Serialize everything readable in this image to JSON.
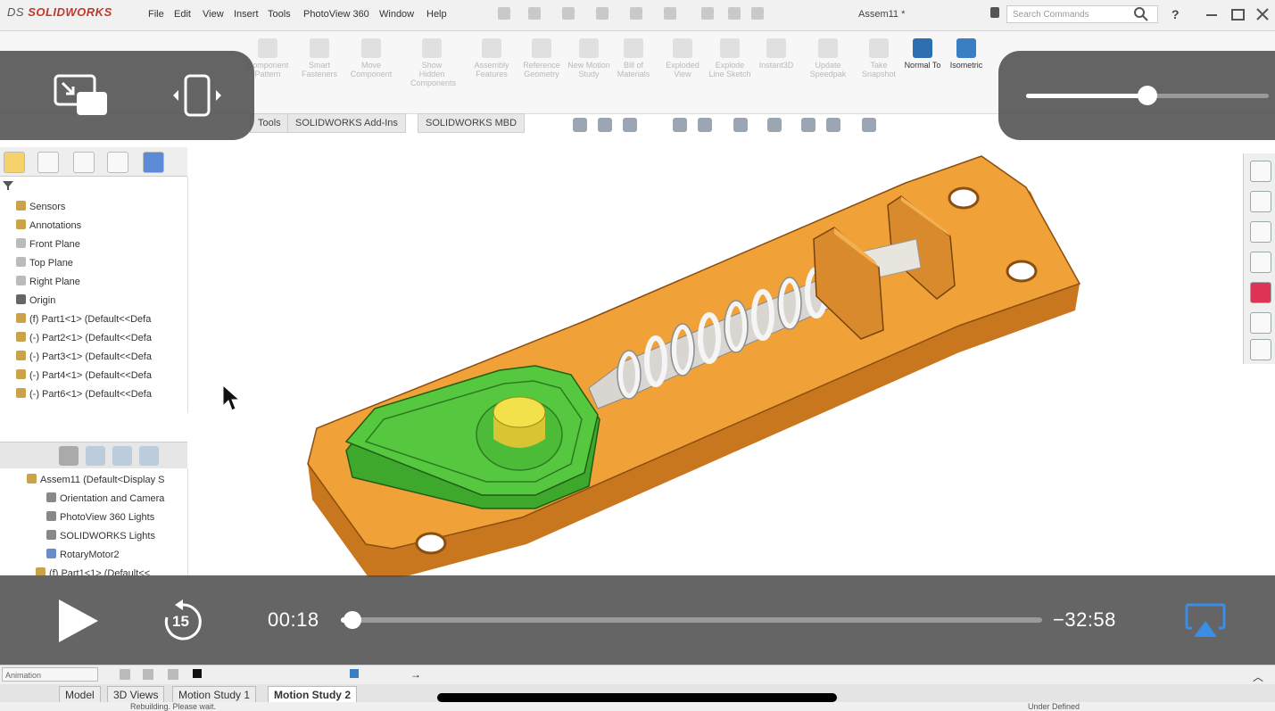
{
  "app": {
    "logo_brand": "SOLIDWORKS",
    "logo_prefix": "DS",
    "menus": [
      "File",
      "Edit",
      "View",
      "Insert",
      "Tools",
      "PhotoView 360",
      "Window",
      "Help"
    ],
    "document_title": "Assem11 *",
    "search_placeholder": "Search Commands",
    "help_label": "?"
  },
  "ribbon": {
    "buttons": [
      {
        "label": "Component Pattern",
        "icon": "pattern-icon",
        "active": false
      },
      {
        "label": "Smart Fasteners",
        "icon": "fastener-icon",
        "active": false
      },
      {
        "label": "Move Component",
        "icon": "move-icon",
        "active": false
      },
      {
        "label": "Show Hidden Components",
        "icon": "show-hidden-icon",
        "active": false
      },
      {
        "label": "Assembly Features",
        "icon": "assembly-feature-icon",
        "active": false
      },
      {
        "label": "Reference Geometry",
        "icon": "reference-geometry-icon",
        "active": false
      },
      {
        "label": "New Motion Study",
        "icon": "motion-study-icon",
        "active": false
      },
      {
        "label": "Bill of Materials",
        "icon": "bom-icon",
        "active": false
      },
      {
        "label": "Exploded View",
        "icon": "exploded-view-icon",
        "active": false
      },
      {
        "label": "Explode Line Sketch",
        "icon": "explode-line-icon",
        "active": false
      },
      {
        "label": "Instant3D",
        "icon": "instant3d-icon",
        "active": false
      },
      {
        "label": "Update Speedpak",
        "icon": "speedpak-icon",
        "active": false
      },
      {
        "label": "Take Snapshot",
        "icon": "snapshot-icon",
        "active": false
      },
      {
        "label": "Normal To",
        "icon": "normal-to-icon",
        "active": true
      },
      {
        "label": "Isometric",
        "icon": "isometric-icon",
        "active": true
      }
    ]
  },
  "tabs": [
    "Tools",
    "SOLIDWORKS Add-Ins",
    "SOLIDWORKS MBD"
  ],
  "feature_tree": {
    "items": [
      {
        "label": "Sensors",
        "icon": "sensors-icon"
      },
      {
        "label": "Annotations",
        "icon": "annotations-icon"
      },
      {
        "label": "Front Plane",
        "icon": "plane-icon"
      },
      {
        "label": "Top Plane",
        "icon": "plane-icon"
      },
      {
        "label": "Right Plane",
        "icon": "plane-icon"
      },
      {
        "label": "Origin",
        "icon": "origin-icon"
      },
      {
        "label": "(f) Part1<1> (Default<<Defa",
        "icon": "part-icon"
      },
      {
        "label": "(-) Part2<1> (Default<<Defa",
        "icon": "part-icon"
      },
      {
        "label": "(-) Part3<1> (Default<<Defa",
        "icon": "part-icon"
      },
      {
        "label": "(-) Part4<1> (Default<<Defa",
        "icon": "part-icon"
      },
      {
        "label": "(-) Part6<1> (Default<<Defa",
        "icon": "part-icon"
      }
    ]
  },
  "motion_tree": {
    "items": [
      {
        "label": "Assem11 (Default<Display S",
        "icon": "assembly-icon"
      },
      {
        "label": "Orientation and Camera",
        "icon": "camera-icon"
      },
      {
        "label": "PhotoView 360 Lights",
        "icon": "lights-icon"
      },
      {
        "label": "SOLIDWORKS Lights",
        "icon": "lights-icon"
      },
      {
        "label": "RotaryMotor2",
        "icon": "motor-icon"
      },
      {
        "label": "(f) Part1<1> (Default<<",
        "icon": "part-icon"
      }
    ]
  },
  "motion_bar": {
    "mode": "Animation"
  },
  "bottom_tabs": [
    {
      "label": "Model",
      "active": false
    },
    {
      "label": "3D Views",
      "active": false
    },
    {
      "label": "Motion Study 1",
      "active": false
    },
    {
      "label": "Motion Study 2",
      "active": true
    }
  ],
  "status": {
    "left": "Rebuilding. Please wait.",
    "right": "Under Defined"
  },
  "player": {
    "elapsed": "00:18",
    "remaining": "−32:58",
    "progress_fraction": 0.016,
    "volume_fraction": 0.5,
    "skip_label": "15",
    "icons": {
      "pip": "picture-in-picture-icon",
      "aspect": "aspect-ratio-icon",
      "play": "play-icon",
      "skip": "skip-back-15-icon",
      "airplay": "airplay-icon"
    }
  },
  "colors": {
    "base_plate": "#f0a238",
    "cam": "#4cc43a",
    "pin": "#f2e14a",
    "spring": "#d9d9d9",
    "overlay": "#505050",
    "airplay": "#3a8ee6"
  }
}
